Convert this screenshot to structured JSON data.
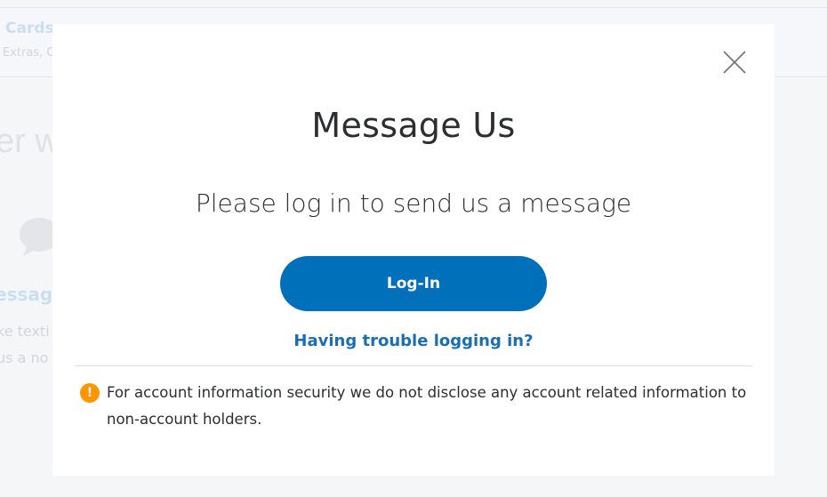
{
  "background": {
    "header_title": "Cards",
    "header_subtitle": "Extras, C",
    "heading": "er w",
    "message_label": "essag",
    "description_line1": "ke texti",
    "description_line2": "us a no"
  },
  "modal": {
    "title": "Message Us",
    "subtitle": "Please log in to send us a message",
    "login_button": "Log-In",
    "trouble_link": "Having trouble logging in?",
    "notice_icon": "!",
    "notice_text": "For account information security we do not disclose any account related information to non-account holders."
  },
  "icons": {
    "close": "close-icon",
    "notice": "exclamation-circle-icon",
    "background_chat": "chat-bubble-icon"
  },
  "colors": {
    "primary_button": "#0070ba",
    "link": "#1a6fb4",
    "warning": "#ff9600",
    "text": "#2c2e2f"
  }
}
